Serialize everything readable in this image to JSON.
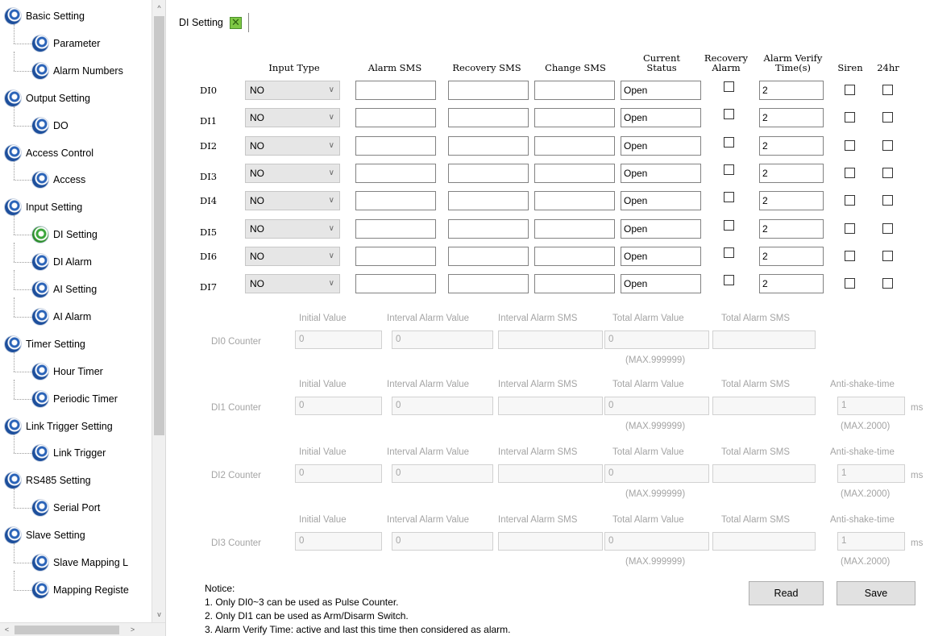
{
  "sidebar": {
    "items": [
      {
        "label": "Basic Setting",
        "level": 0
      },
      {
        "label": "Parameter",
        "level": 1
      },
      {
        "label": "Alarm Numbers",
        "level": 1
      },
      {
        "label": "Output Setting",
        "level": 0
      },
      {
        "label": "DO",
        "level": 1
      },
      {
        "label": "Access Control",
        "level": 0
      },
      {
        "label": "Access",
        "level": 1
      },
      {
        "label": "Input Setting",
        "level": 0
      },
      {
        "label": "DI Setting",
        "level": 1,
        "active": true
      },
      {
        "label": "DI Alarm",
        "level": 1
      },
      {
        "label": "AI  Setting",
        "level": 1
      },
      {
        "label": "AI Alarm",
        "level": 1
      },
      {
        "label": "Timer Setting",
        "level": 0
      },
      {
        "label": "Hour Timer",
        "level": 1
      },
      {
        "label": "Periodic Timer",
        "level": 1
      },
      {
        "label": "Link Trigger Setting",
        "level": 0
      },
      {
        "label": "Link Trigger",
        "level": 1
      },
      {
        "label": "RS485 Setting",
        "level": 0
      },
      {
        "label": "Serial Port",
        "level": 1
      },
      {
        "label": "Slave Setting",
        "level": 0
      },
      {
        "label": "Slave Mapping L",
        "level": 1
      },
      {
        "label": "Mapping Registe",
        "level": 1
      }
    ]
  },
  "tab": {
    "label": "DI Setting",
    "close_glyph": "✕"
  },
  "di_table": {
    "headers": {
      "input_type": "Input Type",
      "alarm_sms": "Alarm SMS",
      "recovery_sms": "Recovery SMS",
      "change_sms": "Change SMS",
      "current_status": [
        "Current",
        "Status"
      ],
      "recovery_alarm": [
        "Recovery",
        "Alarm"
      ],
      "alarm_verify": [
        "Alarm Verify",
        "Time(s)"
      ],
      "siren": "Siren",
      "h24": "24hr"
    },
    "rows": [
      {
        "label": "DI0",
        "input_type": "NO",
        "alarm_sms": "",
        "recovery_sms": "",
        "change_sms": "",
        "status": "Open",
        "recovery_alarm": false,
        "verify_time": "2",
        "siren": false,
        "h24": false
      },
      {
        "label": "DI1",
        "input_type": "NO",
        "alarm_sms": "",
        "recovery_sms": "",
        "change_sms": "",
        "status": "Open",
        "recovery_alarm": false,
        "verify_time": "2",
        "siren": false,
        "h24": false
      },
      {
        "label": "DI2",
        "input_type": "NO",
        "alarm_sms": "",
        "recovery_sms": "",
        "change_sms": "",
        "status": "Open",
        "recovery_alarm": false,
        "verify_time": "2",
        "siren": false,
        "h24": false
      },
      {
        "label": "DI3",
        "input_type": "NO",
        "alarm_sms": "",
        "recovery_sms": "",
        "change_sms": "",
        "status": "Open",
        "recovery_alarm": false,
        "verify_time": "2",
        "siren": false,
        "h24": false
      },
      {
        "label": "DI4",
        "input_type": "NO",
        "alarm_sms": "",
        "recovery_sms": "",
        "change_sms": "",
        "status": "Open",
        "recovery_alarm": false,
        "verify_time": "2",
        "siren": false,
        "h24": false
      },
      {
        "label": "DI5",
        "input_type": "NO",
        "alarm_sms": "",
        "recovery_sms": "",
        "change_sms": "",
        "status": "Open",
        "recovery_alarm": false,
        "verify_time": "2",
        "siren": false,
        "h24": false
      },
      {
        "label": "DI6",
        "input_type": "NO",
        "alarm_sms": "",
        "recovery_sms": "",
        "change_sms": "",
        "status": "Open",
        "recovery_alarm": false,
        "verify_time": "2",
        "siren": false,
        "h24": false
      },
      {
        "label": "DI7",
        "input_type": "NO",
        "alarm_sms": "",
        "recovery_sms": "",
        "change_sms": "",
        "status": "Open",
        "recovery_alarm": false,
        "verify_time": "2",
        "siren": false,
        "h24": false
      }
    ]
  },
  "counters": [
    {
      "name": "DI0 Counter",
      "headers": [
        "Initial Value",
        "Interval Alarm Value",
        "Interval Alarm SMS",
        "Total Alarm Value",
        "Total Alarm SMS"
      ],
      "initial_value": "0",
      "interval_alarm_value": "0",
      "interval_alarm_sms": "",
      "total_alarm_value": "0",
      "total_alarm_sms": "",
      "total_max": "(MAX.999999)"
    },
    {
      "name": "DI1 Counter",
      "headers": [
        "Initial Value",
        "Interval Alarm  Value",
        "Interval Alarm  SMS",
        "Total Alarm Value",
        "Total Alarm SMS"
      ],
      "initial_value": "0",
      "interval_alarm_value": "0",
      "interval_alarm_sms": "",
      "total_alarm_value": "0",
      "total_alarm_sms": "",
      "total_max": "(MAX.999999)",
      "anti_shake": {
        "label": "Anti-shake-time",
        "value": "1",
        "unit": "ms",
        "max": "(MAX.2000)"
      }
    },
    {
      "name": "DI2 Counter",
      "headers": [
        "Initial Value",
        "Interval Alarm  Value",
        "Interval Alarm  SMS",
        "Total Alarm Value",
        "Total Alarm SMS"
      ],
      "initial_value": "0",
      "interval_alarm_value": "0",
      "interval_alarm_sms": "",
      "total_alarm_value": "0",
      "total_alarm_sms": "",
      "total_max": "(MAX.999999)",
      "anti_shake": {
        "label": "Anti-shake-time",
        "value": "1",
        "unit": "ms",
        "max": "(MAX.2000)"
      }
    },
    {
      "name": "DI3 Counter",
      "headers": [
        "Initial Value",
        "Interval Alarm  Value",
        "Interval Alarm  SMS",
        "Total Alarm Value",
        "Total Alarm SMS"
      ],
      "initial_value": "0",
      "interval_alarm_value": "0",
      "interval_alarm_sms": "",
      "total_alarm_value": "0",
      "total_alarm_sms": "",
      "total_max": "(MAX.999999)",
      "anti_shake": {
        "label": "Anti-shake-time",
        "value": "1",
        "unit": "ms",
        "max": "(MAX.2000)"
      }
    }
  ],
  "notice": {
    "title": "Notice:",
    "lines": [
      "1. Only DI0~3 can be used as Pulse Counter.",
      "2. Only DI1 can be used as Arm/Disarm Switch.",
      "3. Alarm Verify Time: active and last this time then considered as alarm."
    ]
  },
  "buttons": {
    "read": "Read",
    "save": "Save"
  },
  "scroll": {
    "up": "^",
    "down": "v",
    "left": "<",
    "right": ">"
  },
  "colors": {
    "tree_icon": "#2a63b8",
    "tree_icon_active": "#3aa63a",
    "tab_close_bg": "#7ec845"
  }
}
